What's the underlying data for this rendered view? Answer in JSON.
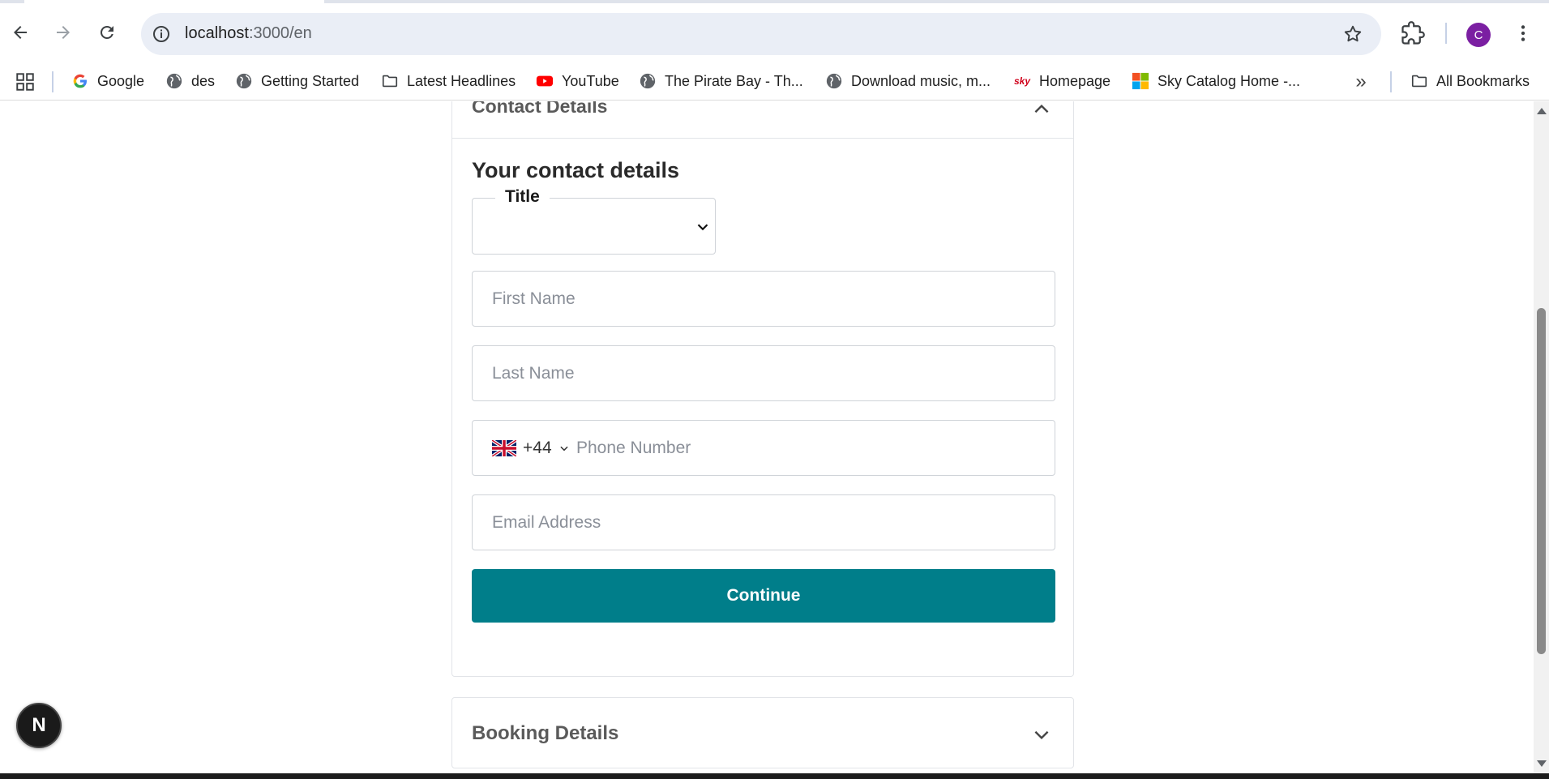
{
  "browser": {
    "url_host": "localhost",
    "url_path": ":3000/en",
    "avatar_letter": "C",
    "bookmarks": [
      {
        "label": "Google",
        "icon": "google-icon"
      },
      {
        "label": "des",
        "icon": "globe-icon"
      },
      {
        "label": "Getting Started",
        "icon": "globe-icon"
      },
      {
        "label": "Latest Headlines",
        "icon": "folder-icon"
      },
      {
        "label": "YouTube",
        "icon": "youtube-icon"
      },
      {
        "label": "The Pirate Bay - Th...",
        "icon": "globe-icon"
      },
      {
        "label": "Download music, m...",
        "icon": "globe-icon"
      },
      {
        "label": "Homepage",
        "icon": "sky-icon"
      },
      {
        "label": "Sky Catalog Home -...",
        "icon": "microsoft-icon"
      }
    ],
    "all_bookmarks": "All Bookmarks"
  },
  "contact": {
    "header": "Contact Details",
    "title": "Your contact details",
    "title_select_label": "Title",
    "first_name_placeholder": "First Name",
    "last_name_placeholder": "Last Name",
    "phone_dial_code": "+44",
    "phone_placeholder": "Phone Number",
    "email_placeholder": "Email Address",
    "continue_label": "Continue"
  },
  "booking": {
    "header": "Booking Details"
  },
  "dev_badge": "N",
  "colors": {
    "accent": "#007e8a",
    "avatar": "#7b1fa2"
  }
}
